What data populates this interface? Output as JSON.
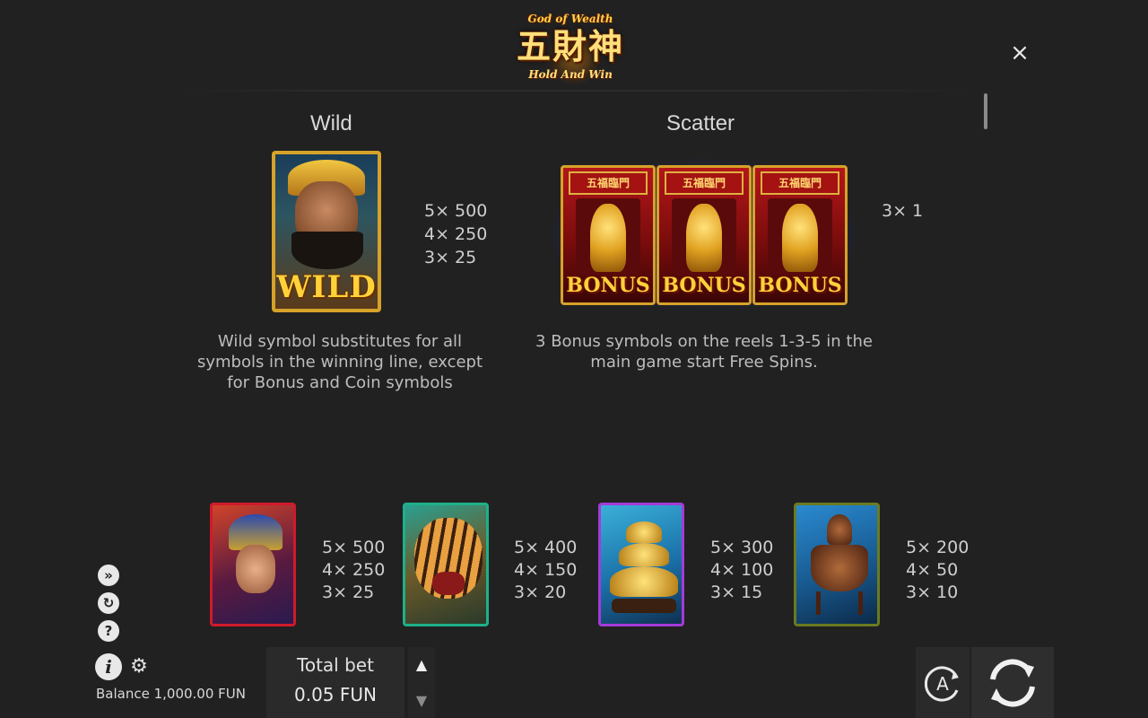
{
  "logo": {
    "top_text": "God of Wealth",
    "main_text": "五財神",
    "bottom_text": "Hold And Win"
  },
  "close_label": "×",
  "wild": {
    "title": "Wild",
    "symbol_label": "WILD",
    "pays": [
      "5× 500",
      "4× 250",
      "3× 25"
    ],
    "description_lines": [
      "Wild symbol substitutes for all",
      "symbols in the winning line, except",
      "for Bonus and Coin symbols"
    ]
  },
  "scatter": {
    "title": "Scatter",
    "banner_text": "五福臨門",
    "symbol_label": "BONUS",
    "pays": [
      "3× 1"
    ],
    "description_lines": [
      "3 Bonus symbols on the reels 1-3-5 in the",
      "main game start Free Spins."
    ]
  },
  "symbols": [
    {
      "name": "emperor",
      "pays": [
        "5× 500",
        "4× 250",
        "3× 25"
      ]
    },
    {
      "name": "tiger",
      "pays": [
        "5× 400",
        "4× 150",
        "3× 20"
      ]
    },
    {
      "name": "gold-ingots",
      "pays": [
        "5× 300",
        "4× 100",
        "3× 15"
      ]
    },
    {
      "name": "bronze-urn",
      "pays": [
        "5× 200",
        "4× 50",
        "3× 10"
      ]
    }
  ],
  "side_icons": [
    "turbo-icon",
    "replay-icon",
    "help-icon",
    "info-icon",
    "gear-icon"
  ],
  "balance": "Balance 1,000.00 FUN",
  "bet": {
    "label": "Total bet",
    "value": "0.05 FUN"
  },
  "controls": {
    "auto_label": "A"
  }
}
